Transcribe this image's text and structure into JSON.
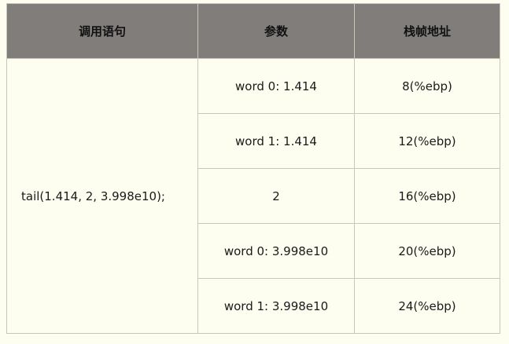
{
  "table": {
    "headers": [
      "调用语句",
      "参数",
      "栈帧地址"
    ],
    "call_statement": "tail(1.414, 2, 3.998e10);",
    "rows": [
      {
        "param": "word 0: 1.414",
        "address": "8(%ebp)"
      },
      {
        "param": "word 1: 1.414",
        "address": "12(%ebp)"
      },
      {
        "param": "2",
        "address": "16(%ebp)"
      },
      {
        "param": "word 0: 3.998e10",
        "address": "20(%ebp)"
      },
      {
        "param": "word 1: 3.998e10",
        "address": "24(%ebp)"
      }
    ]
  },
  "colors": {
    "header_bg": "#807d7a",
    "body_bg": "#fdfdf0",
    "border": "#c8c8b8"
  }
}
